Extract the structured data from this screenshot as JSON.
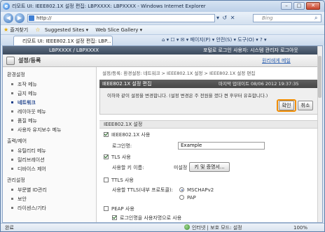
{
  "window": {
    "title": "리모트 UI: IEEE802.1X 설정 편집: LBPXXXX: LBPXXXX - Windows Internet Explorer",
    "min": "–",
    "max": "□",
    "close": "✕"
  },
  "addressbar": {
    "url": "http://",
    "search_placeholder": "Bing",
    "tools": "▾ ↺ ✕"
  },
  "favorites": {
    "label": "즐겨찾기",
    "items": [
      "Suggested Sites ▾",
      "Web Slice Gallery ▾"
    ]
  },
  "tab": {
    "label": "리모트 UI: IEEE802.1X 설정 편집: LBP..."
  },
  "commandbar": "⌂ ▾  ☐ ▾  ✉ ▾  페이지(P) ▾  안전(S) ▾  도구(O) ▾  ? ▾",
  "app": {
    "device": "LBPXXXX / LBPXXXX",
    "login": "포털로  로그인 사용자: 시스템 관리자 로그아웃",
    "title": "설정/등록",
    "back_link": "원리에게 메일"
  },
  "sidebar": {
    "sections": [
      {
        "label": "환경설정",
        "items": [
          "조작 메뉴",
          "급지 메뉴",
          "네트워크",
          "레이아웃 메뉴",
          "품질 메뉴",
          "사용자 유지보수 메뉴"
        ]
      },
      {
        "label": "출력/제어",
        "items": [
          "유틸리티 메뉴",
          "릴리브레이션",
          "디바이스 제어"
        ]
      },
      {
        "label": "관리설정",
        "items": [
          "부문별 ID관리",
          "보안",
          "라이센스/기타"
        ]
      }
    ],
    "active": "네트워크"
  },
  "main": {
    "breadcrumb": "설정/등록: 환경설정: 네트워크 > IEEE802.1X 설정 > IEEE802.1X 설정 편집",
    "panel_title": "IEEE802.1X 설정 편집",
    "last_update": "마지막 업데이트 08/06 2012 19:37:35",
    "notice": "이하와 같이 설정을 변경합니다. (설정 변경은 주 전원을 껐다 켠 후부터 유효합니다.)",
    "ok_label": "확인",
    "cancel_label": "취소",
    "section_title": "IEEE802.1X 설정",
    "use_8021x_label": "IEEE802.1X 사용",
    "login_name_label": "로그인명:",
    "login_name_value": "Example",
    "tls_label": "TLS 사용",
    "key_name_label": "사용할 키 이름:",
    "key_name_value": "미설정",
    "key_button_label": "키 및 증명서...",
    "ttls_label": "TTLS 사용",
    "ttls_protocol_label": "사용할 TTLS(내부 프로토콜):",
    "mschap_label": "MSCHAPv2",
    "pap_label": "PAP",
    "peap_label": "PEAP 사용",
    "use_login_name_label": "로그인명을 사용자명으로 사용"
  },
  "status": {
    "left": "완료",
    "zone": "인터넷 | 보호 모드: 설정",
    "zoom": "100%"
  }
}
